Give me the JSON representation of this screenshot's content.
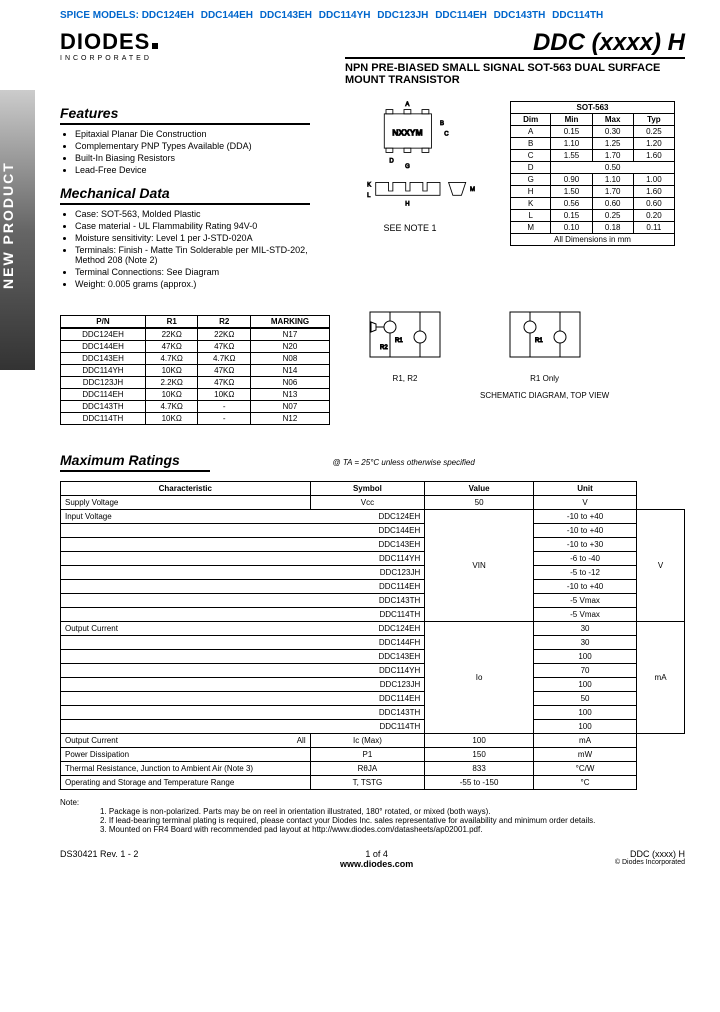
{
  "spice_label": "SPICE MODELS:",
  "spice_models": [
    "DDC124EH",
    "DDC144EH",
    "DDC143EH",
    "DDC114YH",
    "DDC123JH",
    "DDC114EH",
    "DDC143TH",
    "DDC114TH"
  ],
  "logo": {
    "main": "DIODES",
    "sub": "INCORPORATED"
  },
  "title": "DDC (xxxx) H",
  "subtitle": "NPN PRE-BIASED SMALL SIGNAL SOT-563 DUAL SURFACE MOUNT TRANSISTOR",
  "sidebar": "NEW PRODUCT",
  "features": {
    "heading": "Features",
    "items": [
      "Epitaxial Planar Die Construction",
      "Complementary PNP Types Available (DDA)",
      "Built-In Biasing Resistors",
      "Lead-Free Device"
    ]
  },
  "mechanical": {
    "heading": "Mechanical Data",
    "items": [
      "Case: SOT-563, Molded Plastic",
      "Case material - UL Flammability Rating 94V-0",
      "Moisture sensitivity: Level 1 per J-STD-020A",
      "Terminals: Finish - Matte Tin Solderable per MIL-STD-202, Method 208 (Note 2)",
      "Terminal Connections: See Diagram",
      "Weight: 0.005 grams (approx.)"
    ]
  },
  "package_label": "NXXYM",
  "see_note": "SEE NOTE 1",
  "dim_table": {
    "title": "SOT-563",
    "headers": [
      "Dim",
      "Min",
      "Max",
      "Typ"
    ],
    "rows": [
      [
        "A",
        "0.15",
        "0.30",
        "0.25"
      ],
      [
        "B",
        "1.10",
        "1.25",
        "1.20"
      ],
      [
        "C",
        "1.55",
        "1.70",
        "1.60"
      ],
      [
        "D",
        "",
        "0.50",
        ""
      ],
      [
        "G",
        "0.90",
        "1.10",
        "1.00"
      ],
      [
        "H",
        "1.50",
        "1.70",
        "1.60"
      ],
      [
        "K",
        "0.56",
        "0.60",
        "0.60"
      ],
      [
        "L",
        "0.15",
        "0.25",
        "0.20"
      ],
      [
        "M",
        "0.10",
        "0.18",
        "0.11"
      ]
    ],
    "footer": "All Dimensions in mm"
  },
  "pn_table": {
    "headers": [
      "P/N",
      "R1",
      "R2",
      "MARKING"
    ],
    "rows": [
      [
        "DDC124EH",
        "22KΩ",
        "22KΩ",
        "N17"
      ],
      [
        "DDC144EH",
        "47KΩ",
        "47KΩ",
        "N20"
      ],
      [
        "DDC143EH",
        "4.7KΩ",
        "4.7KΩ",
        "N08"
      ],
      [
        "DDC114YH",
        "10KΩ",
        "47KΩ",
        "N14"
      ],
      [
        "DDC123JH",
        "2.2KΩ",
        "47KΩ",
        "N06"
      ],
      [
        "DDC114EH",
        "10KΩ",
        "10KΩ",
        "N13"
      ],
      [
        "DDC143TH",
        "4.7KΩ",
        "-",
        "N07"
      ],
      [
        "DDC114TH",
        "10KΩ",
        "-",
        "N12"
      ]
    ]
  },
  "schematic_labels": {
    "left": "R1, R2",
    "right": "R1 Only",
    "caption": "SCHEMATIC DIAGRAM, TOP VIEW"
  },
  "ratings": {
    "heading": "Maximum Ratings",
    "condition": "@ TA = 25°C unless otherwise specified",
    "headers": [
      "Characteristic",
      "Symbol",
      "Value",
      "Unit"
    ],
    "rows": [
      {
        "c": "Supply Voltage",
        "s": "Vcc",
        "v": "50",
        "u": "V"
      },
      {
        "c": "Input Voltage",
        "parts": [
          "DDC124EH",
          "DDC144EH",
          "DDC143EH",
          "DDC114YH",
          "DDC123JH",
          "DDC114EH",
          "DDC143TH",
          "DDC114TH"
        ],
        "s": "VIN",
        "vals": [
          "-10 to +40",
          "-10 to +40",
          "-10 to +30",
          "-6 to -40",
          "-5 to -12",
          "-10 to +40",
          "-5 Vmax",
          "-5 Vmax"
        ],
        "u": "V"
      },
      {
        "c": "Output Current",
        "parts": [
          "DDC124EH",
          "DDC144FH",
          "DDC143EH",
          "DDC114YH",
          "DDC123JH",
          "DDC114EH",
          "DDC143TH",
          "DDC114TH"
        ],
        "s": "Io",
        "vals": [
          "30",
          "30",
          "100",
          "70",
          "100",
          "50",
          "100",
          "100"
        ],
        "u": "mA"
      },
      {
        "c": "Output Current",
        "extra": "All",
        "s": "Ic (Max)",
        "v": "100",
        "u": "mA"
      },
      {
        "c": "Power Dissipation",
        "s": "P1",
        "v": "150",
        "u": "mW"
      },
      {
        "c": "Thermal Resistance, Junction to Ambient Air (Note 3)",
        "s": "RθJA",
        "v": "833",
        "u": "°C/W"
      },
      {
        "c": "Operating and Storage and Temperature Range",
        "s": "T, TSTG",
        "v": "-55 to -150",
        "u": "°C"
      }
    ]
  },
  "notes": {
    "label": "Note:",
    "items": [
      "1. Package is non-polarized. Parts may be on reel in orientation illustrated, 180° rotated, or mixed (both ways).",
      "2. If lead-bearing terminal plating is required, please contact your Diodes Inc. sales representative for availability and minimum order details.",
      "3. Mounted on FR4 Board with recommended pad layout at http://www.diodes.com/datasheets/ap02001.pdf."
    ]
  },
  "footer": {
    "rev": "DS30421 Rev. 1 - 2",
    "page": "1 of 4",
    "url": "www.diodes.com",
    "right": "DDC (xxxx) H",
    "copyright": "© Diodes Incorporated"
  }
}
